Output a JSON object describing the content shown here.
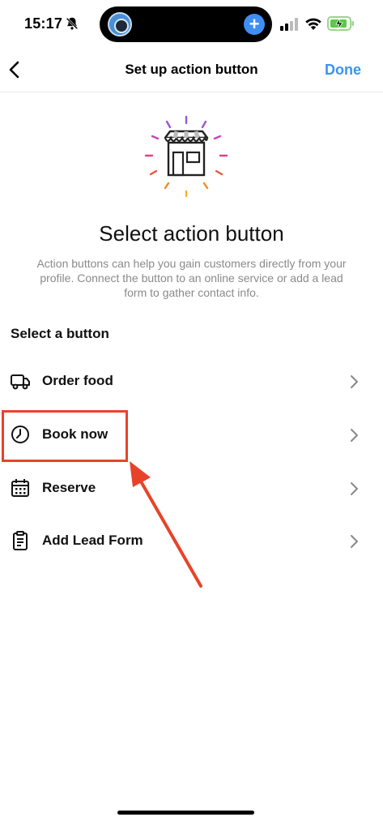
{
  "status_bar": {
    "time": "15:17",
    "icons": [
      "bell-off-icon",
      "signal-icon",
      "wifi-icon",
      "battery-charging-icon"
    ],
    "island_plus": "+"
  },
  "nav": {
    "back_icon": "chevron-left-icon",
    "title": "Set up action button",
    "done_label": "Done"
  },
  "colors": {
    "accent": "#3b93f0",
    "highlight": "#e8432a",
    "muted_text": "#8a8a8a"
  },
  "main": {
    "illustration_icon": "storefront-icon",
    "heading": "Select action button",
    "description": "Action buttons can help you gain customers directly from your profile. Connect the button to an online service or add a lead form to gather contact info.",
    "section_label": "Select a button",
    "options": [
      {
        "label": "Order food",
        "icon": "delivery-truck-icon"
      },
      {
        "label": "Book now",
        "icon": "clock-icon",
        "highlighted": true
      },
      {
        "label": "Reserve",
        "icon": "calendar-icon"
      },
      {
        "label": "Add Lead Form",
        "icon": "clipboard-icon"
      }
    ]
  }
}
